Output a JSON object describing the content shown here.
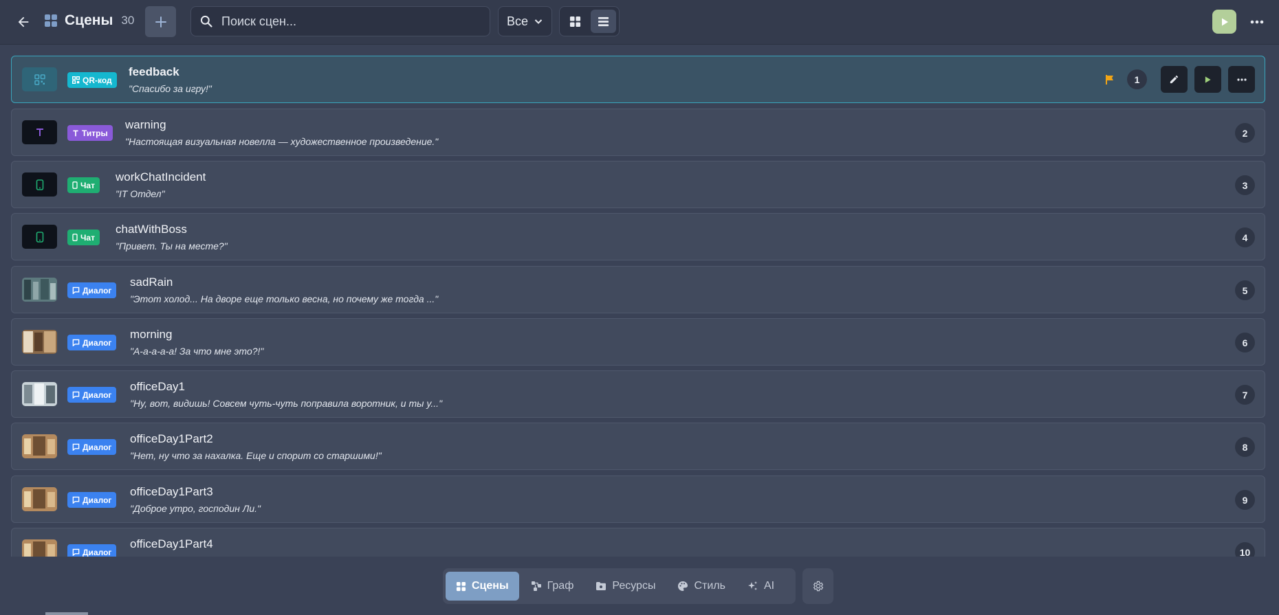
{
  "header": {
    "title": "Сцены",
    "count": "30",
    "search_placeholder": "Поиск сцен...",
    "filter_label": "Все"
  },
  "scenes": [
    {
      "num": "1",
      "name": "feedback",
      "type": "QR-код",
      "quote": "\"Спасибо за игру!\""
    },
    {
      "num": "2",
      "name": "warning",
      "type": "Титры",
      "quote": "\"Настоящая визуальная новелла — художественное произведение.\""
    },
    {
      "num": "3",
      "name": "workChatIncident",
      "type": "Чат",
      "quote": "\"IT Отдел\""
    },
    {
      "num": "4",
      "name": "chatWithBoss",
      "type": "Чат",
      "quote": "\"Привет. Ты на месте?\""
    },
    {
      "num": "5",
      "name": "sadRain",
      "type": "Диалог",
      "quote": "\"Этот холод... На дворе еще только весна, но почему же тогда ...\""
    },
    {
      "num": "6",
      "name": "morning",
      "type": "Диалог",
      "quote": "\"А-а-а-а-а! За что мне это?!\""
    },
    {
      "num": "7",
      "name": "officeDay1",
      "type": "Диалог",
      "quote": "\"Ну, вот, видишь! Совсем чуть-чуть поправила воротник, и ты у...\""
    },
    {
      "num": "8",
      "name": "officeDay1Part2",
      "type": "Диалог",
      "quote": "\"Нет, ну что за нахалка. Еще и спорит со старшими!\""
    },
    {
      "num": "9",
      "name": "officeDay1Part3",
      "type": "Диалог",
      "quote": "\"Доброе утро, господин Ли.\""
    },
    {
      "num": "10",
      "name": "officeDay1Part4",
      "type": "Диалог",
      "quote": ""
    }
  ],
  "bottom_nav": {
    "scenes": "Сцены",
    "graph": "Граф",
    "resources": "Ресурсы",
    "style": "Стиль",
    "ai": "AI"
  },
  "colors": {
    "accent_selected_border": "#3aa6bd",
    "badge_qr": "#15b7cf",
    "badge_titles": "#8a5ad9",
    "badge_chat": "#1fae72",
    "badge_dialog": "#3b82f0",
    "play_button": "#b3cf9a",
    "flag": "#f2a516"
  }
}
